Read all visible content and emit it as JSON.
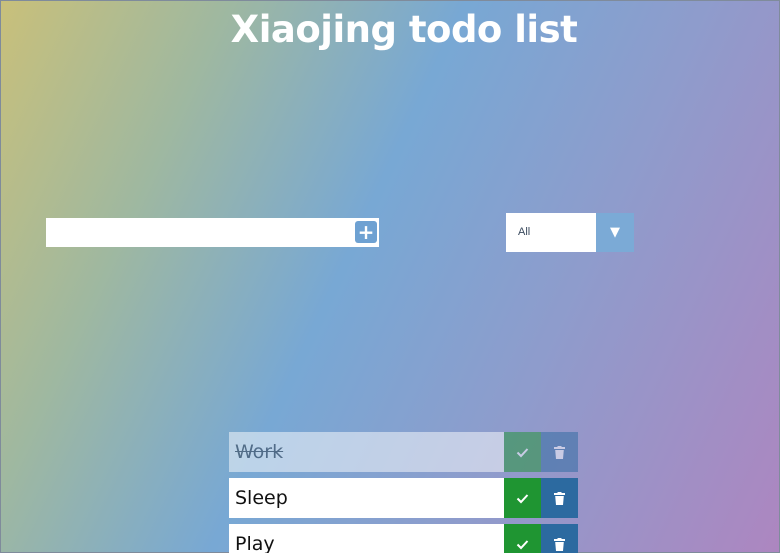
{
  "header": {
    "title": "Xiaojing todo list"
  },
  "form": {
    "input_value": "",
    "input_placeholder": "",
    "add_button_icon": "plus-square-icon"
  },
  "filter": {
    "selected": "All",
    "arrow_icon": "caret-down-icon"
  },
  "todos": [
    {
      "text": "Work",
      "completed": true
    },
    {
      "text": "Sleep",
      "completed": false
    },
    {
      "text": "Play",
      "completed": false
    }
  ],
  "colors": {
    "check_button": "#1f9532",
    "trash_button": "#2c6aa0",
    "accent": "#6ea1d2"
  }
}
